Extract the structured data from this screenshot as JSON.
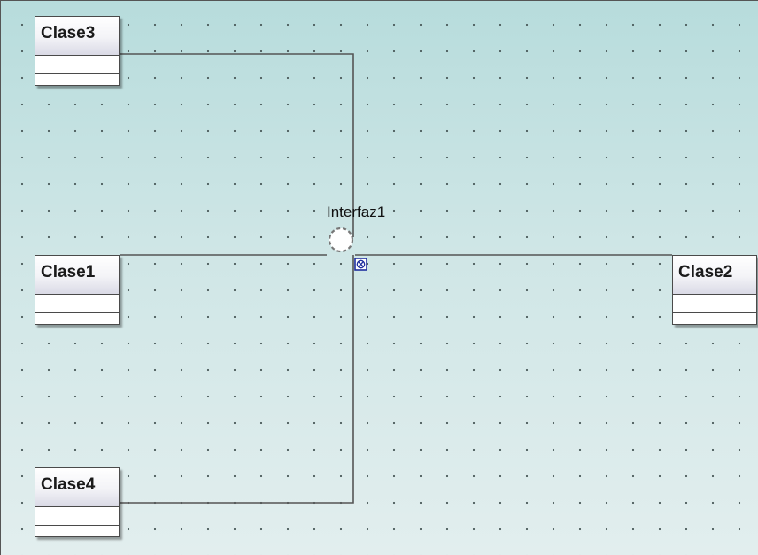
{
  "diagram": {
    "classes": [
      {
        "id": "clase3",
        "name": "Clase3"
      },
      {
        "id": "clase1",
        "name": "Clase1"
      },
      {
        "id": "clase2",
        "name": "Clase2"
      },
      {
        "id": "clase4",
        "name": "Clase4"
      }
    ],
    "interface": {
      "name": "Interfaz1"
    },
    "connections": [
      {
        "from": "Clase3",
        "to": "Interfaz1"
      },
      {
        "from": "Clase1",
        "to": "Interfaz1"
      },
      {
        "from": "Clase2",
        "to": "Interfaz1"
      },
      {
        "from": "Clase4",
        "to": "Interfaz1"
      }
    ],
    "colors": {
      "line": "#555555",
      "selector": "#1f2f9f",
      "background": "#cfe6e6"
    }
  }
}
